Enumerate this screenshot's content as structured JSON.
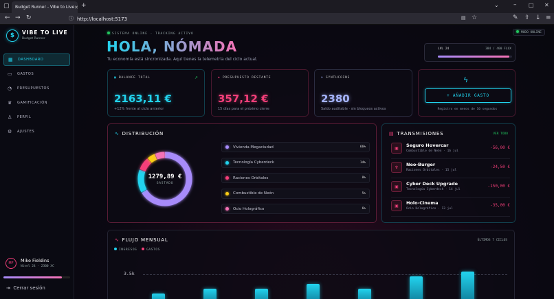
{
  "browser": {
    "tab_title": "Budget Runner - Vibe to Live",
    "url": "http://localhost:5173"
  },
  "sidebar": {
    "brand": "VIBE TO LIVE",
    "brand_sub": "Budget Runner",
    "items": [
      {
        "label": "DASHBOARD",
        "icon": "dashboard-icon",
        "active": true
      },
      {
        "label": "GASTOS",
        "icon": "wallet-icon"
      },
      {
        "label": "PRESUPUESTOS",
        "icon": "pie-icon"
      },
      {
        "label": "GAMIFICACIÓN",
        "icon": "trophy-icon"
      },
      {
        "label": "PERFIL",
        "icon": "user-icon"
      },
      {
        "label": "AJUSTES",
        "icon": "gear-icon"
      }
    ],
    "user": {
      "initials": "MF",
      "name": "Mike Fieldins",
      "level": "Nivel 24 · 2300 XC",
      "progress": 0.88
    },
    "logout": "Cerrar sesión"
  },
  "header": {
    "status": "SISTEMA ONLINE · TRACKING ACTIVO",
    "title": "HOLA, NÓMADA",
    "subtitle": "Tu economía está sincronizada. Aquí tienes la telemetría del ciclo actual.",
    "online": "MODO ONLINE",
    "level": {
      "label": "LVL 24",
      "xp": "384 / 400 FLUX",
      "progress": 0.96
    }
  },
  "kpis": [
    {
      "label": "BALANCE TOTAL",
      "value": "2163,11 €",
      "foot": "+12% frente al ciclo anterior",
      "color": "#22d3ee"
    },
    {
      "label": "PRESUPUESTO RESTANTE",
      "value": "357,12 €",
      "foot": "15 días para el próximo cierre",
      "color": "#f43f7a"
    },
    {
      "label": "SYNTHCOINS",
      "value": "2380",
      "foot": "Saldo auditable · sin bloqueos activos",
      "color": "#a5b4fc"
    }
  ],
  "add_expense": {
    "label": "+ AÑADIR GASTO",
    "foot": "Registro en menos de 10 segundos"
  },
  "distribution": {
    "title": "DISTRIBUCIÓN",
    "total": "1279,89 €",
    "total_label": "GASTADO",
    "items": [
      {
        "label": "Vivienda Megaciudad",
        "pct": "66%",
        "value": 66,
        "color": "#a78bfa"
      },
      {
        "label": "Tecnología Cyberdeck",
        "pct": "14%",
        "value": 14,
        "color": "#22d3ee"
      },
      {
        "label": "Raciones Orbitales",
        "pct": "8%",
        "value": 8,
        "color": "#f43f7a"
      },
      {
        "label": "Combustible de Neón",
        "pct": "5%",
        "value": 5,
        "color": "#facc15"
      },
      {
        "label": "Ocio Holográfico",
        "pct": "6%",
        "value": 6,
        "color": "#f472b6"
      }
    ]
  },
  "transmissions": {
    "title": "TRANSMISIONES",
    "see_all": "VER TODO",
    "items": [
      {
        "title": "Seguro Hovercar",
        "sub": "Combustible de Neón · 16 jul",
        "amount": "-56,00 €"
      },
      {
        "title": "Neo-Burger",
        "sub": "Raciones Orbitales · 15 jul",
        "amount": "-24,50 €"
      },
      {
        "title": "Cyber Deck Upgrade",
        "sub": "Tecnología Cyberdeck · 14 jul",
        "amount": "-150,00 €"
      },
      {
        "title": "Holo-Cinema",
        "sub": "Ocio Holográfico · 13 jul",
        "amount": "-35,00 €"
      }
    ]
  },
  "flow": {
    "title": "FLUJO MENSUAL",
    "period": "ÚLTIMOS 7 CICLOS",
    "legend_income": "INGRESOS",
    "legend_expense": "GASTOS",
    "y_tick": "3.5k",
    "chart_data": {
      "type": "bar",
      "series": [
        {
          "name": "INGRESOS",
          "values": [
            2750,
            2950,
            2950,
            3150,
            2950,
            3500,
            3700
          ]
        }
      ],
      "ylim": [
        0,
        4000
      ]
    }
  }
}
